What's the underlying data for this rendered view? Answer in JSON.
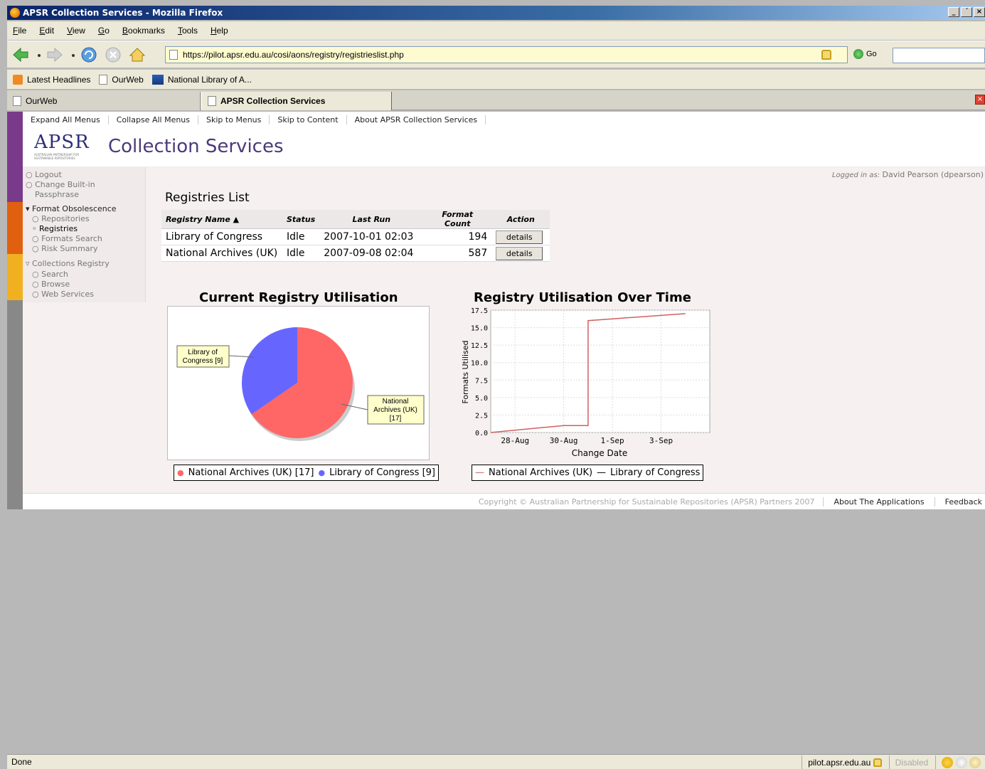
{
  "window": {
    "title": "APSR Collection Services - Mozilla Firefox",
    "min": "_",
    "max": "´",
    "close": "×"
  },
  "menu": [
    "File",
    "Edit",
    "View",
    "Go",
    "Bookmarks",
    "Tools",
    "Help"
  ],
  "url": "https://pilot.apsr.edu.au/cosi/aons/registry/registrieslist.php",
  "go_label": "Go",
  "bookmarks": [
    "Latest Headlines",
    "OurWeb",
    "National Library of A..."
  ],
  "tabs": [
    "OurWeb",
    "APSR Collection Services"
  ],
  "skip_links": [
    "Expand All Menus",
    "Collapse All Menus",
    "Skip to Menus",
    "Skip to Content",
    "About APSR Collection Services"
  ],
  "logo": {
    "text": "APSR",
    "tagline": "AUSTRALIAN PARTNERSHIP FOR SUSTAINABLE REPOSITORIES"
  },
  "app_title": "Collection Services",
  "logged_in": {
    "label": "Logged in as:",
    "user": "David Pearson (dpearson)"
  },
  "sidebar": {
    "logout": "Logout",
    "change_pass_1": "Change Built-in",
    "change_pass_2": "Passphrase",
    "format_obs": "Format Obsolescence",
    "repositories": "Repositories",
    "registries": "Registries",
    "formats_search": "Formats Search",
    "risk_summary": "Risk Summary",
    "collections_registry": "Collections Registry",
    "search": "Search",
    "browse": "Browse",
    "web_services": "Web Services"
  },
  "registries": {
    "title": "Registries List",
    "headers": [
      "Registry Name ▲",
      "Status",
      "Last Run",
      "Format Count",
      "Action"
    ],
    "rows": [
      {
        "name": "Library of Congress",
        "status": "Idle",
        "last_run": "2007-10-01 02:03",
        "count": "194",
        "action": "details"
      },
      {
        "name": "National Archives (UK)",
        "status": "Idle",
        "last_run": "2007-09-08 02:04",
        "count": "587",
        "action": "details"
      }
    ]
  },
  "colors": {
    "national_archives": "#ff6666",
    "library_of_congress": "#6666ff",
    "line": "#d06060"
  },
  "chart_data": [
    {
      "type": "pie",
      "title": "Current Registry Utilisation",
      "categories": [
        "National Archives (UK)",
        "Library of Congress"
      ],
      "values": [
        17,
        9
      ],
      "slice_labels": [
        "National Archives (UK) [17]",
        "Library of Congress [9]"
      ],
      "legend": [
        "National Archives (UK) [17]",
        "Library of Congress [9]"
      ],
      "legend_position": "bottom"
    },
    {
      "type": "line",
      "title": "Registry Utilisation Over Time",
      "xlabel": "Change Date",
      "ylabel": "Formats Utilised",
      "x_ticks": [
        "28-Aug",
        "30-Aug",
        "1-Sep",
        "3-Sep"
      ],
      "y_ticks": [
        "0.0",
        "2.5",
        "5.0",
        "7.5",
        "10.0",
        "12.5",
        "15.0",
        "17.5"
      ],
      "ylim": [
        0,
        17.5
      ],
      "grid": true,
      "series": [
        {
          "name": "National Archives (UK)",
          "x": [
            "27-Aug",
            "30-Aug",
            "31-Aug",
            "31-Aug",
            "4-Sep"
          ],
          "y": [
            0,
            1,
            1,
            16,
            17
          ]
        },
        {
          "name": "Library of Congress",
          "x": [],
          "y": []
        }
      ],
      "legend": [
        "National Archives (UK)",
        "Library of Congress"
      ],
      "legend_position": "bottom"
    }
  ],
  "footer": {
    "copyright": "Copyright © Australian Partnership for Sustainable Repositories (APSR) Partners 2007",
    "about": "About The Applications",
    "feedback": "Feedback"
  },
  "status": {
    "left": "Done",
    "host": "pilot.apsr.edu.au",
    "disabled": "Disabled"
  }
}
